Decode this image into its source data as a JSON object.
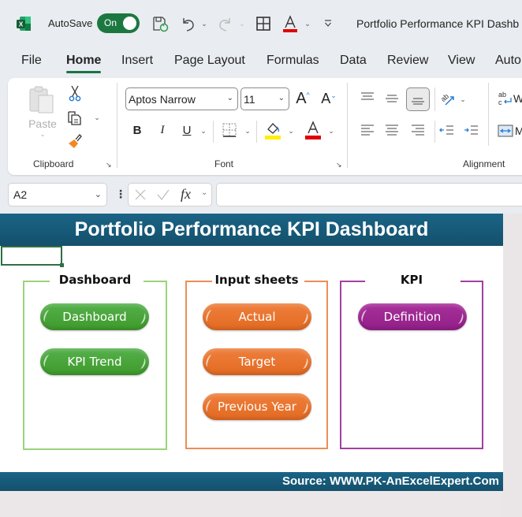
{
  "titlebar": {
    "app_icon": "excel-logo-icon",
    "autosave_label": "AutoSave",
    "autosave_state": "On",
    "document_title": "Portfolio Performance KPI Dashb",
    "quick_access": [
      "save-sync-icon",
      "undo-icon",
      "redo-icon",
      "borders-icon",
      "font-color-icon",
      "customize-toolbar-icon"
    ]
  },
  "menu": {
    "tabs": [
      {
        "label": "File"
      },
      {
        "label": "Home",
        "active": true
      },
      {
        "label": "Insert"
      },
      {
        "label": "Page Layout"
      },
      {
        "label": "Formulas"
      },
      {
        "label": "Data"
      },
      {
        "label": "Review"
      },
      {
        "label": "View"
      },
      {
        "label": "Auto"
      }
    ]
  },
  "ribbon": {
    "clipboard": {
      "label": "Clipboard",
      "paste_label": "Paste"
    },
    "font": {
      "label": "Font",
      "font_name": "Aptos Narrow",
      "font_size": "11",
      "bold": "B",
      "italic": "I",
      "underline": "U",
      "font_color_letter": "A",
      "highlight_color": "#ffef00",
      "font_color": "#e00000"
    },
    "alignment": {
      "label": "Alignment",
      "wrap_partial": "W",
      "merge_partial": "M"
    }
  },
  "formula_bar": {
    "name_box": "A2",
    "fx_label": "fx",
    "formula_value": ""
  },
  "sheet": {
    "title": "Portfolio Performance KPI Dashboard",
    "footer": "Source: WWW.PK-AnExcelExpert.Com",
    "colors": {
      "band": "#175a79",
      "green": "#4ca53c",
      "orange": "#e8742e",
      "purple": "#9e2893"
    },
    "panels": [
      {
        "title": "Dashboard",
        "buttons": [
          "Dashboard",
          "KPI Trend"
        ]
      },
      {
        "title": "Input sheets",
        "buttons": [
          "Actual",
          "Target",
          "Previous Year"
        ]
      },
      {
        "title": "KPI",
        "buttons": [
          "Definition"
        ]
      }
    ]
  }
}
